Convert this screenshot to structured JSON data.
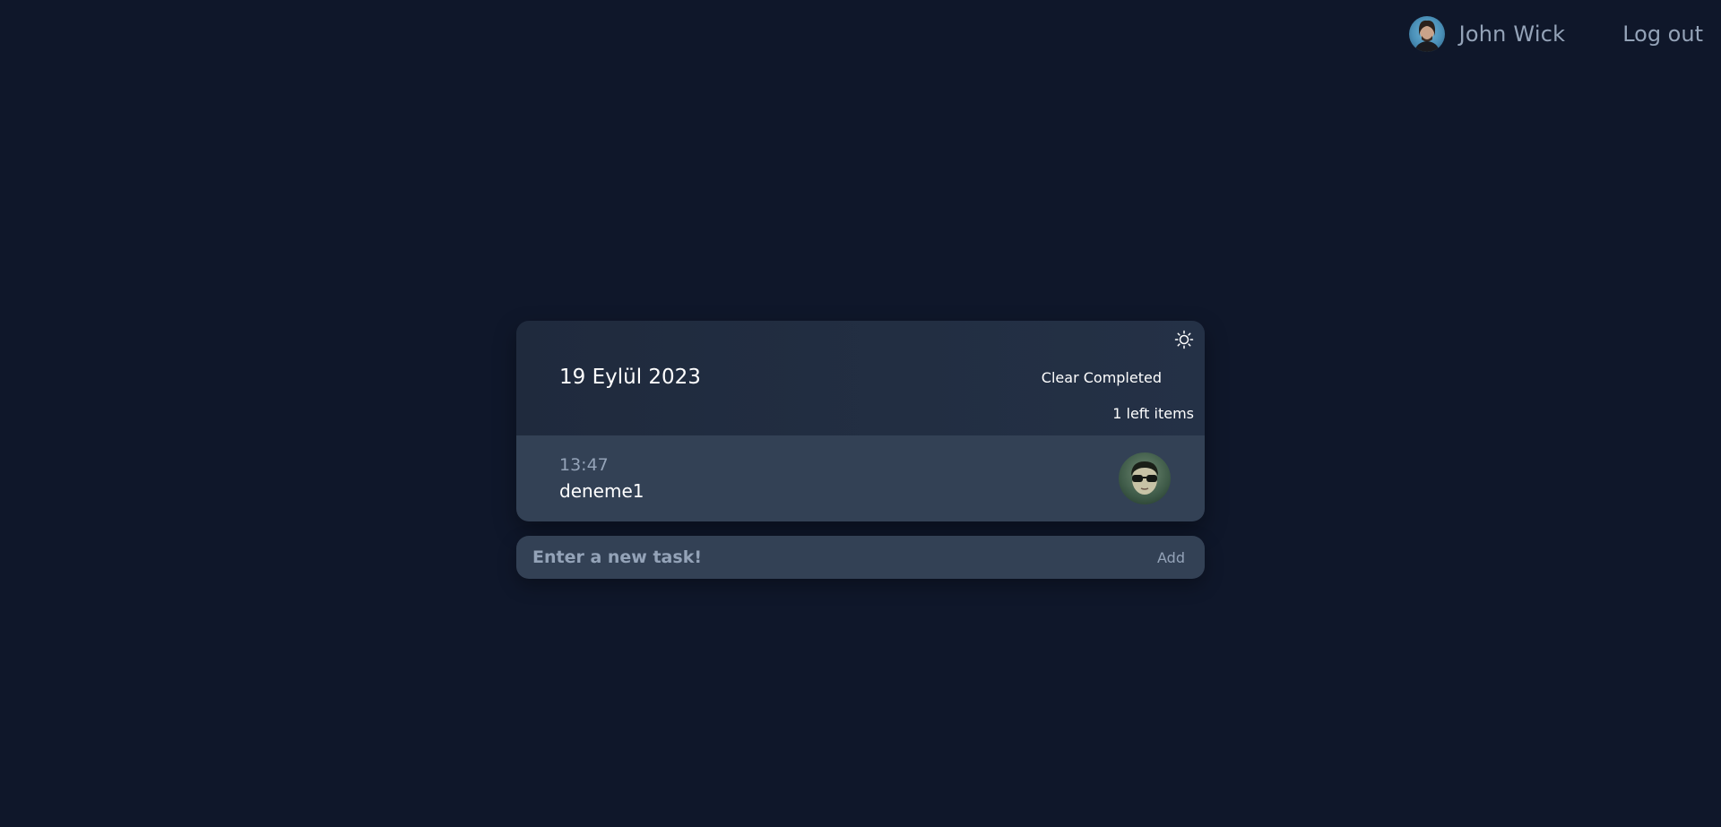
{
  "header": {
    "user_name": "John Wick",
    "logout_label": "Log out",
    "avatar_icon": "user-avatar"
  },
  "todo": {
    "date": "19 Eylül 2023",
    "clear_completed_label": "Clear Completed",
    "left_items": "1 left items",
    "theme_icon": "sun-icon",
    "tasks": [
      {
        "time": "13:47",
        "title": "deneme1",
        "avatar_icon": "assignee-avatar"
      }
    ]
  },
  "new_task": {
    "placeholder": "Enter a new task!",
    "value": "",
    "add_label": "Add"
  },
  "colors": {
    "background": "#0f172a",
    "card_header": "#1f2a3d",
    "task_row": "#334155",
    "muted_text": "#94a3b8"
  }
}
